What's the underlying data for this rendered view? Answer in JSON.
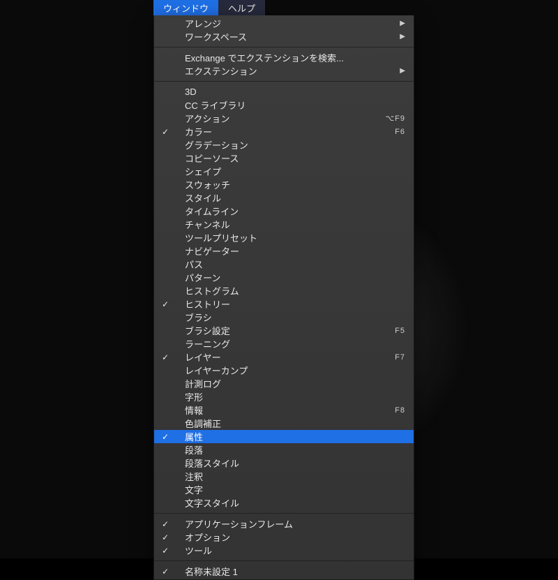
{
  "menubar": {
    "window": "ウィンドウ",
    "help": "ヘルプ"
  },
  "menu": {
    "arrange": "アレンジ",
    "workspace": "ワークスペース",
    "exchange_search": "Exchange でエクステンションを検索...",
    "extensions": "エクステンション",
    "three_d": "3D",
    "cc_libraries": "CC ライブラリ",
    "actions": "アクション",
    "actions_shortcut": "⌥F9",
    "color": "カラー",
    "color_shortcut": "F6",
    "gradients": "グラデーション",
    "copy_source": "コピーソース",
    "shapes": "シェイプ",
    "swatches": "スウォッチ",
    "styles": "スタイル",
    "timeline": "タイムライン",
    "channels": "チャンネル",
    "tool_presets": "ツールプリセット",
    "navigator": "ナビゲーター",
    "paths": "パス",
    "patterns": "パターン",
    "histogram": "ヒストグラム",
    "history": "ヒストリー",
    "brushes": "ブラシ",
    "brush_settings": "ブラシ設定",
    "brush_settings_shortcut": "F5",
    "learning": "ラーニング",
    "layers": "レイヤー",
    "layers_shortcut": "F7",
    "layer_comps": "レイヤーカンプ",
    "measurement_log": "計測ログ",
    "glyphs": "字形",
    "info": "情報",
    "info_shortcut": "F8",
    "adjustments": "色調補正",
    "properties": "属性",
    "paragraph": "段落",
    "paragraph_styles": "段落スタイル",
    "notes": "注釈",
    "character": "文字",
    "character_styles": "文字スタイル",
    "app_frame": "アプリケーションフレーム",
    "options": "オプション",
    "tools": "ツール",
    "untitled1": "名称未設定 1"
  }
}
